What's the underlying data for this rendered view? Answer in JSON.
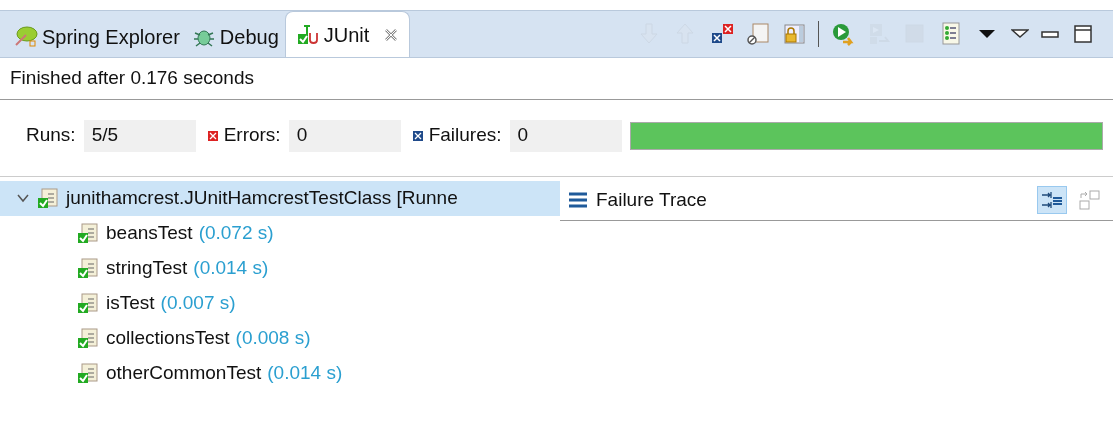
{
  "tabs": [
    {
      "kind": "spring",
      "label": "Spring Explorer",
      "selected": false
    },
    {
      "kind": "debug",
      "label": "Debug",
      "selected": false
    },
    {
      "kind": "junit",
      "label": "JUnit",
      "selected": true,
      "closable": true
    }
  ],
  "toolbar": [
    {
      "kind": "next-failure",
      "disabled": true
    },
    {
      "kind": "previous-failure",
      "disabled": true
    },
    {
      "kind": "failures-only",
      "disabled": false
    },
    {
      "kind": "skipped",
      "disabled": false
    },
    {
      "kind": "scroll-lock",
      "disabled": false
    },
    {
      "kind": "separator"
    },
    {
      "kind": "rerun",
      "disabled": false
    },
    {
      "kind": "rerun-failed",
      "disabled": true
    },
    {
      "kind": "stop",
      "disabled": true
    },
    {
      "kind": "history",
      "disabled": false
    },
    {
      "kind": "dropdown",
      "disabled": false
    },
    {
      "kind": "view-menu",
      "disabled": false
    },
    {
      "kind": "minimize",
      "disabled": false
    },
    {
      "kind": "maximize",
      "disabled": false
    }
  ],
  "status": "Finished after 0.176 seconds",
  "counters": [
    {
      "kind": "runs",
      "label": "Runs:",
      "value": "5/5"
    },
    {
      "kind": "errors",
      "label": "Errors:",
      "value": "0"
    },
    {
      "kind": "failures",
      "label": "Failures:",
      "value": "0"
    }
  ],
  "progress": {
    "level": 1,
    "color": "#5cc45c"
  },
  "tree": [
    {
      "name": "junithamcrest.JUnitHamcrestTestClass [Runne",
      "expanded": true,
      "selected": true,
      "children": [
        {
          "name": "beansTest",
          "time": "(0.072 s)",
          "selected": false
        },
        {
          "name": "stringTest",
          "time": "(0.014 s)",
          "selected": false
        },
        {
          "name": "isTest",
          "time": "(0.007 s)",
          "selected": false
        },
        {
          "name": "collectionsTest",
          "time": "(0.008 s)",
          "selected": false
        },
        {
          "name": "otherCommonTest",
          "time": "(0.014 s)",
          "selected": false
        }
      ]
    }
  ],
  "failure_trace": {
    "title": "Failure Trace",
    "tools": [
      {
        "kind": "filter-stack",
        "on": true
      },
      {
        "kind": "compare",
        "on": false
      }
    ]
  }
}
